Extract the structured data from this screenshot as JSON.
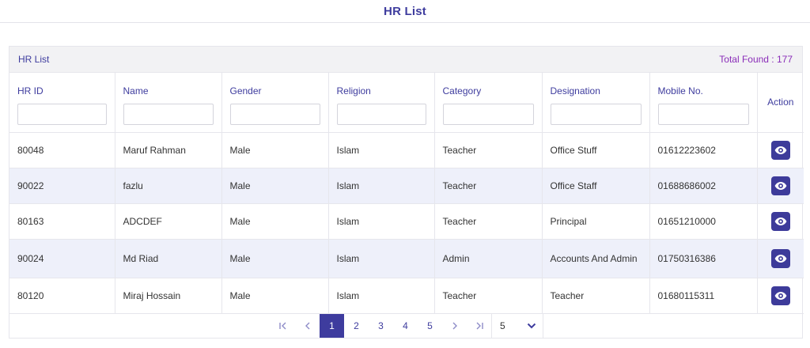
{
  "page": {
    "title": "HR List"
  },
  "card": {
    "title": "HR List",
    "total_found": "Total Found : 177"
  },
  "columns": [
    "HR ID",
    "Name",
    "Gender",
    "Religion",
    "Category",
    "Designation",
    "Mobile No.",
    "Action"
  ],
  "filters": [
    "",
    "",
    "",
    "",
    "",
    "",
    ""
  ],
  "rows": [
    {
      "hr_id": "80048",
      "name": "Maruf Rahman",
      "gender": "Male",
      "religion": "Islam",
      "category": "Teacher",
      "designation": "Office Stuff",
      "mobile": "01612223602"
    },
    {
      "hr_id": "90022",
      "name": "fazlu",
      "gender": "Male",
      "religion": "Islam",
      "category": "Teacher",
      "designation": "Office Staff",
      "mobile": "01688686002"
    },
    {
      "hr_id": "80163",
      "name": "ADCDEF",
      "gender": "Male",
      "religion": "Islam",
      "category": "Teacher",
      "designation": "Principal",
      "mobile": "01651210000"
    },
    {
      "hr_id": "90024",
      "name": "Md Riad",
      "gender": "Male",
      "religion": "Islam",
      "category": "Admin",
      "designation": "Accounts And Admin",
      "mobile": "01750316386"
    },
    {
      "hr_id": "80120",
      "name": "Miraj Hossain",
      "gender": "Male",
      "religion": "Islam",
      "category": "Teacher",
      "designation": "Teacher",
      "mobile": "01680115311"
    }
  ],
  "icons": {
    "view": "eye-icon",
    "first": "first-page-icon",
    "prev": "prev-page-icon",
    "next": "next-page-icon",
    "last": "last-page-icon",
    "dropdown": "chevron-down-icon"
  },
  "pagination": {
    "pages": [
      "1",
      "2",
      "3",
      "4",
      "5"
    ],
    "current": "1",
    "page_size": "5"
  },
  "colors": {
    "accent": "#3e3c9e",
    "total_found": "#8a2db8",
    "striped_row": "#eef0fa"
  }
}
